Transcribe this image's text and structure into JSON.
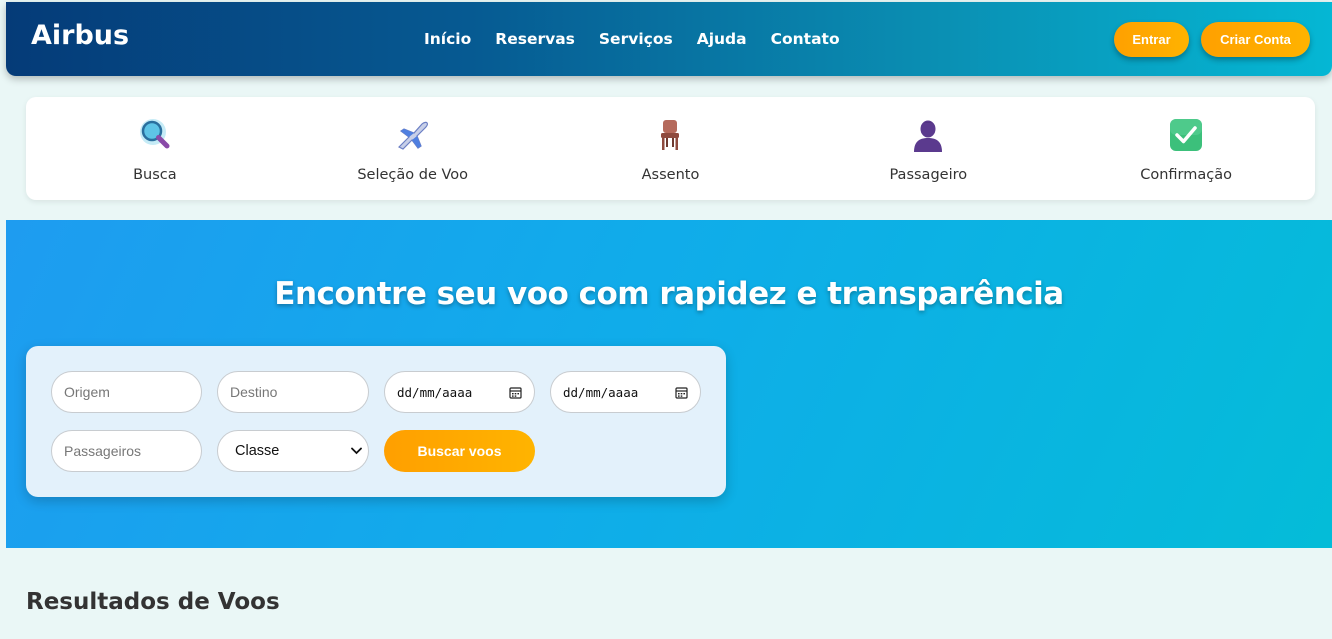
{
  "header": {
    "logo": "Airbus",
    "nav": [
      "Início",
      "Reservas",
      "Serviços",
      "Ajuda",
      "Contato"
    ],
    "login_label": "Entrar",
    "signup_label": "Criar Conta"
  },
  "steps": [
    {
      "label": "Busca",
      "icon": "magnifier-icon"
    },
    {
      "label": "Seleção de Voo",
      "icon": "airplane-icon"
    },
    {
      "label": "Assento",
      "icon": "chair-icon"
    },
    {
      "label": "Passageiro",
      "icon": "passenger-icon"
    },
    {
      "label": "Confirmação",
      "icon": "checkmark-icon"
    }
  ],
  "hero": {
    "title": "Encontre seu voo com rapidez e transparência"
  },
  "search": {
    "origin_placeholder": "Origem",
    "destination_placeholder": "Destino",
    "departure_date": "dd/mm/aaaa",
    "return_date": "dd/mm/aaaa",
    "passengers_placeholder": "Passageiros",
    "class_selected": "Classe",
    "submit_label": "Buscar voos"
  },
  "results": {
    "title": "Resultados de Voos"
  },
  "colors": {
    "accent": "#ffa000",
    "header_start": "#053b78",
    "header_end": "#05b7d4",
    "hero_start": "#1e9cf0",
    "hero_end": "#04bcd8"
  }
}
